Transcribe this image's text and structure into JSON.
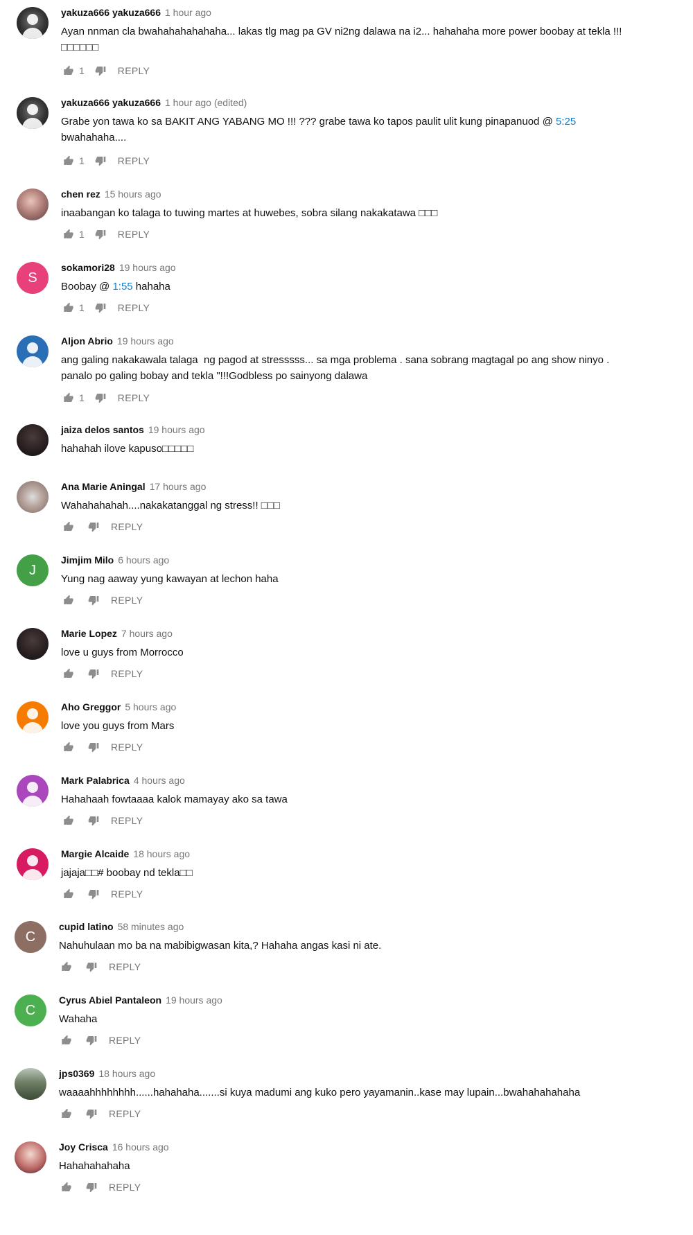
{
  "comments": [
    {
      "author": "yakuza666 yakuza666",
      "time": "1 hour ago",
      "text": "Ayan nnman cla bwahahahahahaha... lakas tlg mag pa GV ni2ng dalawa na i2... hahahaha more power boobay at tekla !!!\n□□□□□□",
      "likes": "1",
      "reply": "REPLY",
      "avatar_icon": "masked-person-photo-icon",
      "avatar_letter": ""
    },
    {
      "author": "yakuza666 yakuza666",
      "time": "1 hour ago (edited)",
      "text_before": "Grabe yon tawa ko sa BAKIT ANG YABANG MO !!! ??? grabe tawa ko tapos paulit ulit kung pinapanuod @ ",
      "timestamp": "5:25",
      "text_after": "\nbwahahaha....",
      "likes": "1",
      "reply": "REPLY",
      "avatar_icon": "masked-person-photo-icon"
    },
    {
      "author": "chen rez",
      "time": "15 hours ago",
      "text": "inaabangan ko talaga to tuwing martes at huwebes, sobra silang nakakatawa □□□",
      "likes": "1",
      "reply": "REPLY",
      "avatar_icon": "user-photo-icon"
    },
    {
      "author": "sokamori28",
      "time": "19 hours ago",
      "text_before": "Boobay @ ",
      "timestamp": "1:55",
      "text_after": " hahaha",
      "likes": "1",
      "reply": "REPLY",
      "avatar_letter": "S",
      "avatar_color": "#e8407a"
    },
    {
      "author": "Aljon Abrio",
      "time": "19 hours ago",
      "text": "ang galing nakakawala talaga  ng pagod at stresssss... sa mga problema . sana sobrang magtagal po ang show ninyo .\npanalo po galing bobay and tekla \"!!!Godbless po sainyong dalawa",
      "likes": "1",
      "reply": "REPLY",
      "avatar_icon": "default-person-icon",
      "avatar_color": "#2a6fb6"
    },
    {
      "author": "jaiza delos santos",
      "time": "19 hours ago",
      "text": "hahahah ilove kapuso□□□□□",
      "likes": "",
      "reply": "",
      "avatar_icon": "user-photo-icon"
    },
    {
      "author": "Ana Marie Aningal",
      "time": "17 hours ago",
      "text": "Wahahahahah....nakakatanggal ng stress!! □□□",
      "likes": "",
      "reply": "REPLY",
      "avatar_icon": "ring-photo-icon"
    },
    {
      "author": "Jimjim Milo",
      "time": "6 hours ago",
      "text": "Yung nag aaway yung kawayan at lechon haha",
      "likes": "",
      "reply": "REPLY",
      "avatar_letter": "J",
      "avatar_color": "#43a047"
    },
    {
      "author": "Marie Lopez",
      "time": "7 hours ago",
      "text": "love u guys from Morrocco",
      "likes": "",
      "reply": "REPLY",
      "avatar_icon": "user-photo-icon"
    },
    {
      "author": "Aho Greggor",
      "time": "5 hours ago",
      "text": "love you guys from Mars",
      "likes": "",
      "reply": "REPLY",
      "avatar_icon": "default-person-icon",
      "avatar_color": "#f57c00"
    },
    {
      "author": "Mark Palabrica",
      "time": "4 hours ago",
      "text": "Hahahaah fowtaaaa kalok mamayay ako sa tawa",
      "likes": "",
      "reply": "REPLY",
      "avatar_icon": "default-person-icon",
      "avatar_color": "#ab47bc"
    },
    {
      "author": "Margie Alcaide",
      "time": "18 hours ago",
      "text": "jajaja□□# boobay nd tekla□□",
      "likes": "",
      "reply": "REPLY",
      "avatar_icon": "default-person-icon",
      "avatar_color": "#d81b60"
    },
    {
      "author": "cupid latino",
      "time": "58 minutes ago",
      "text": "Nahuhulaan mo ba na mabibigwasan kita,? Hahaha angas kasi ni ate.",
      "likes": "",
      "reply": "REPLY",
      "avatar_letter": "C",
      "avatar_color": "#8d6e63"
    },
    {
      "author": "Cyrus Abiel Pantaleon",
      "time": "19 hours ago",
      "text": "Wahaha",
      "likes": "",
      "reply": "REPLY",
      "avatar_letter": "C",
      "avatar_color": "#4caf50"
    },
    {
      "author": "jps0369",
      "time": "18 hours ago",
      "text": "waaaahhhhhhhh......hahahaha.......si kuya madumi ang kuko pero yayamanin..kase may lupain...bwahahahahaha",
      "likes": "",
      "reply": "REPLY",
      "avatar_icon": "landscape-photo-icon"
    },
    {
      "author": "Joy Crisca",
      "time": "16 hours ago",
      "text": "Hahahahahaha",
      "likes": "",
      "reply": "REPLY",
      "avatar_icon": "user-photo-icon"
    }
  ]
}
